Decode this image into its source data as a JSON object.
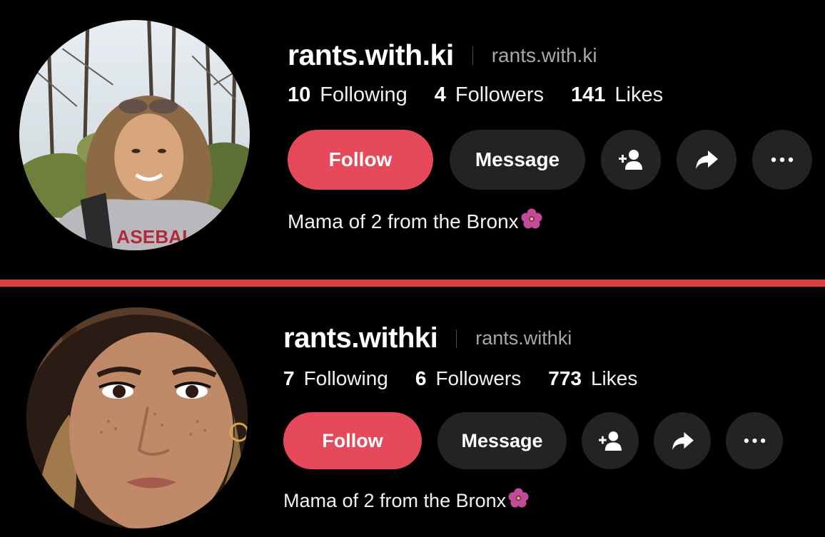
{
  "colors": {
    "background": "#000000",
    "divider": "#d94040",
    "follow_button": "#e64a5a",
    "secondary_button": "#232323",
    "nickname_text": "#a8a8a8"
  },
  "profiles": [
    {
      "username": "rants.with.ki",
      "nickname": "rants.with.ki",
      "stats": [
        {
          "value": "10",
          "label": "Following"
        },
        {
          "value": "4",
          "label": "Followers"
        },
        {
          "value": "141",
          "label": "Likes"
        }
      ],
      "follow_label": "Follow",
      "message_label": "Message",
      "icons": [
        "add-friend-icon",
        "share-icon",
        "more-icon"
      ],
      "bio": "Mama of 2 from the Bronx",
      "bio_emoji": "flower-icon"
    },
    {
      "username": "rants.withki",
      "nickname": "rants.withki",
      "stats": [
        {
          "value": "7",
          "label": "Following"
        },
        {
          "value": "6",
          "label": "Followers"
        },
        {
          "value": "773",
          "label": "Likes"
        }
      ],
      "follow_label": "Follow",
      "message_label": "Message",
      "icons": [
        "add-friend-icon",
        "share-icon",
        "more-icon"
      ],
      "bio": "Mama of 2 from the Bronx",
      "bio_emoji": "flower-icon"
    }
  ]
}
